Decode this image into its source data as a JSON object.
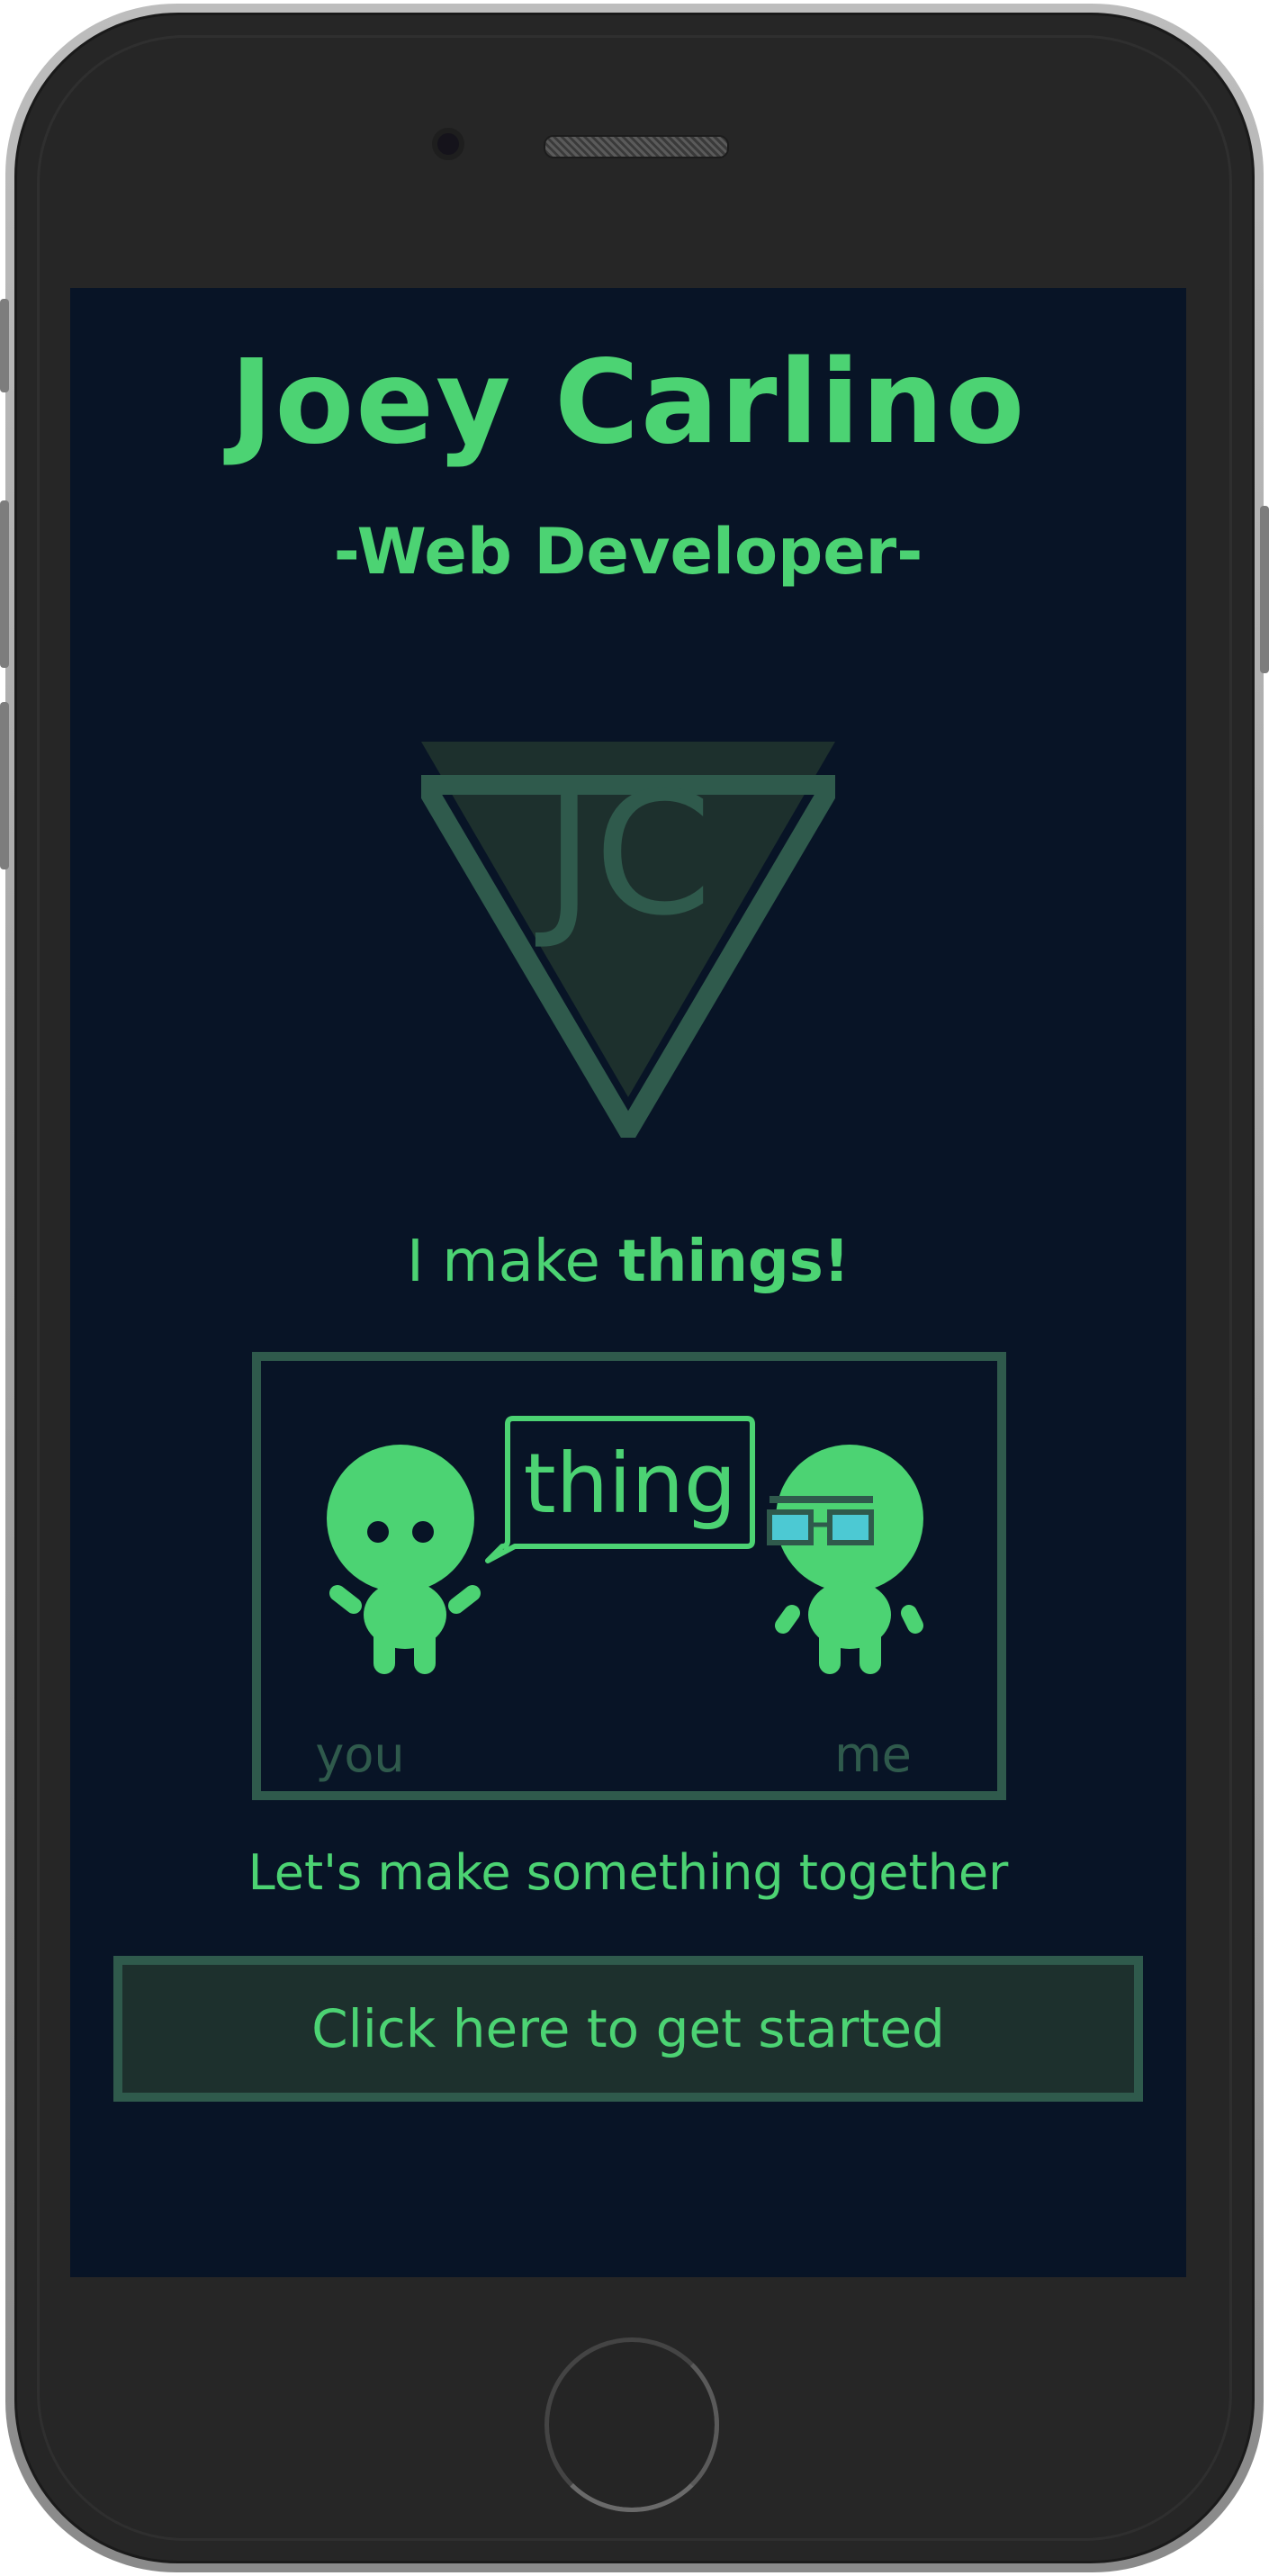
{
  "profile": {
    "name": "Joey Carlino",
    "role": "-Web Developer-"
  },
  "logo": {
    "monogram": "JC",
    "icon": "triangle-monogram-logo"
  },
  "tagline": {
    "prefix": "I make ",
    "emphasis": "things!"
  },
  "illustration": {
    "speech_bubble": "thing",
    "left_label": "you",
    "right_label": "me"
  },
  "cta": {
    "text": "Let's make something together",
    "button_label": "Click here to get started"
  },
  "colors": {
    "accent_green": "#4cd373",
    "muted_green": "#2f5a4c",
    "screen_bg": "#081426",
    "button_bg": "#1d302d",
    "glasses_lens": "#4cc9d3"
  }
}
